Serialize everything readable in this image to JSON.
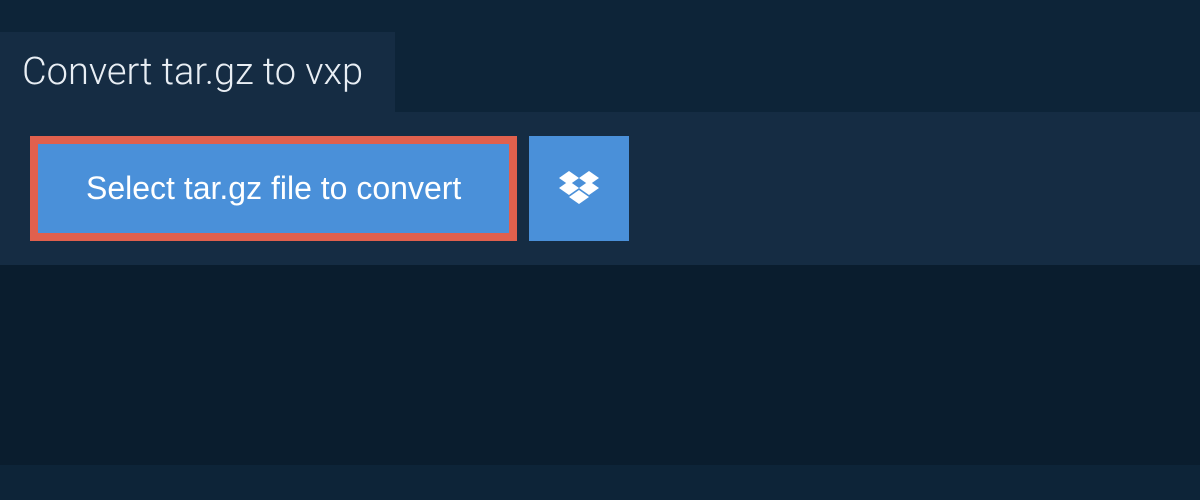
{
  "tab": {
    "title": "Convert tar.gz to vxp"
  },
  "actions": {
    "select_file_label": "Select tar.gz file to convert",
    "dropbox_icon": "dropbox-icon"
  },
  "colors": {
    "background": "#0d2438",
    "panel": "#152c43",
    "button": "#4a90d9",
    "highlight_border": "#e0604d"
  }
}
